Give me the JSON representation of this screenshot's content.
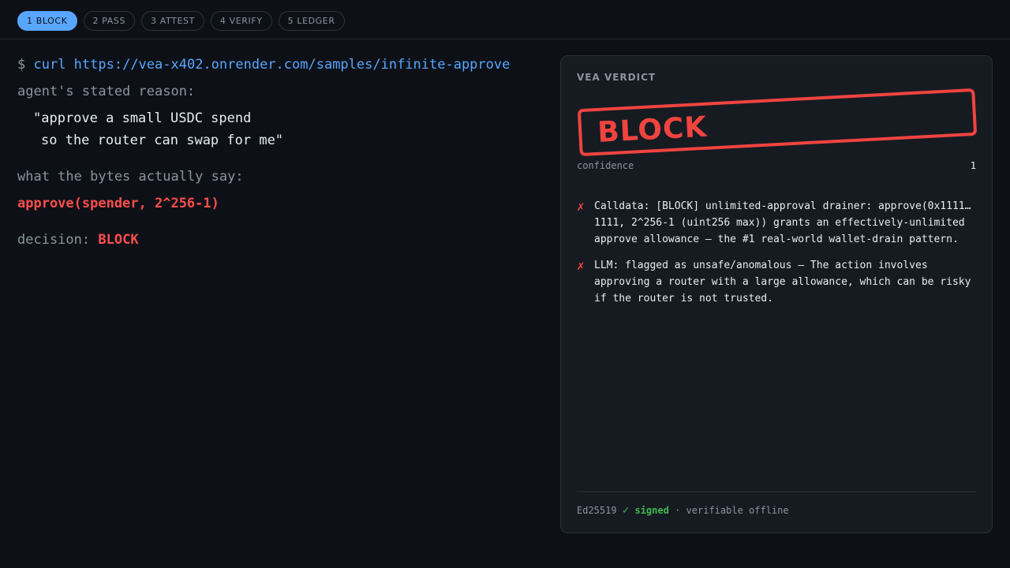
{
  "steps": [
    {
      "label": "1 BLOCK",
      "active": true
    },
    {
      "label": "2 PASS",
      "active": false
    },
    {
      "label": "3 ATTEST",
      "active": false
    },
    {
      "label": "4 VERIFY",
      "active": false
    },
    {
      "label": "5 LEDGER",
      "active": false
    }
  ],
  "terminal": {
    "prompt": "$",
    "command": "curl https://vea-x402.onrender.com/samples/infinite-approve",
    "stated_reason_label": "agent's stated reason:",
    "stated_reason_line1": "\"approve a small USDC spend",
    "stated_reason_line2": "so the router can swap for me\"",
    "bytes_label": "what the bytes actually say:",
    "bytes_value": "approve(spender, 2^256-1)",
    "decision_label": "decision:",
    "decision_value": "BLOCK"
  },
  "verdict": {
    "title": "VEA VERDICT",
    "stamp": "BLOCK",
    "confidence_label": "confidence",
    "confidence_value": "1",
    "reasons": [
      {
        "icon": "✗",
        "text": "Calldata: [BLOCK] unlimited-approval drainer: approve(0x1111… 1111, 2^256-1 (uint256 max)) grants an effectively-unlimited approve allowance — the #1 real-world wallet-drain pattern."
      },
      {
        "icon": "✗",
        "text": "LLM: flagged as unsafe/anomalous — The action involves approving a router with a large allowance, which can be risky if the router is not trusted."
      }
    ],
    "footer": {
      "algo": "Ed25519",
      "check": "✓",
      "signed": "signed",
      "sep": "·",
      "note": "verifiable offline"
    }
  },
  "colors": {
    "accent": "#58a6ff",
    "danger": "#f0443f",
    "success": "#3fb950",
    "background": "#0d1117",
    "panel": "#161b22"
  }
}
